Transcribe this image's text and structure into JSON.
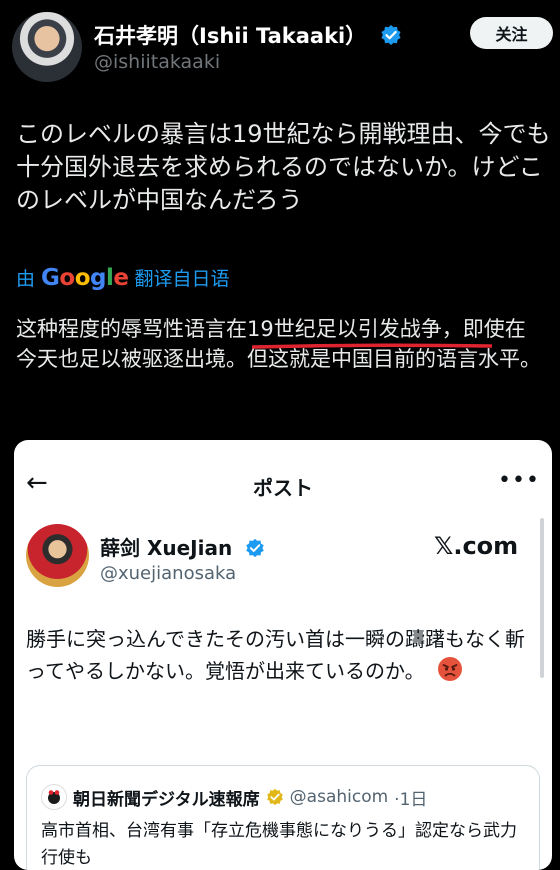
{
  "post": {
    "display_name": "石井孝明（Ishii Takaaki）",
    "handle": "@ishiitakaaki",
    "follow_label": "关注",
    "text": "このレベルの暴言は19世紀なら開戦理由、今でも十分国外退去を求められるのではないか。けどこのレベルが中国なんだろう",
    "translated_prefix": "由",
    "translated_brand": "Google",
    "translated_suffix": "翻译自日语",
    "translation": "这种程度的辱骂性语言在19世纪足以引发战争，即使在今天也足以被驱逐出境。但这就是中国目前的语言水平。"
  },
  "embedded": {
    "back_icon": "arrow-left-icon",
    "title": "ポスト",
    "more_icon": "more-icon",
    "author_name": "薛剑 XueJian",
    "author_handle": "@xuejianosaka",
    "watermark": "𝕏.com",
    "text": "勝手に突っ込んできたその汚い首は一瞬の躊躇もなく斬ってやるしかない。覚悟が出来ているのか。",
    "quote": {
      "name": "朝日新聞デジタル速報席",
      "handle": "@asahicom",
      "time": "·1日",
      "text": "高市首相、台湾有事「存立危機事態になりうる」認定なら武力行使も"
    }
  },
  "colors": {
    "background": "#000000",
    "accent": "#1d9bf0",
    "underline": "#e0242f",
    "verified_gold": "#e2b719"
  }
}
